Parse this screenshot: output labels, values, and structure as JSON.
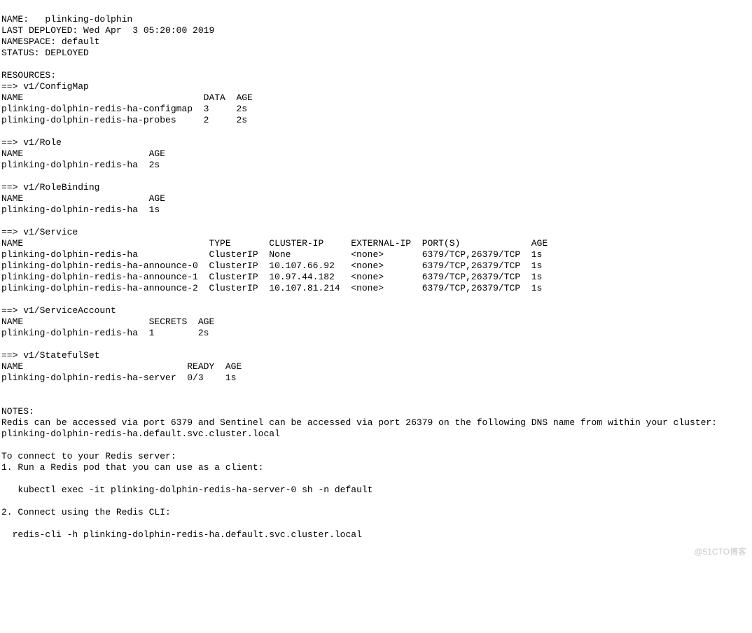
{
  "header": {
    "name_line": "NAME:   plinking-dolphin",
    "last_deployed": "LAST DEPLOYED: Wed Apr  3 05:20:00 2019",
    "namespace": "NAMESPACE: default",
    "status": "STATUS: DEPLOYED"
  },
  "sections": {
    "resources_heading": "RESOURCES:",
    "configmap": {
      "heading": "==> v1/ConfigMap",
      "headers": "NAME                                 DATA  AGE",
      "rows": [
        "plinking-dolphin-redis-ha-configmap  3     2s",
        "plinking-dolphin-redis-ha-probes     2     2s"
      ]
    },
    "role": {
      "heading": "==> v1/Role",
      "headers": "NAME                       AGE",
      "rows": [
        "plinking-dolphin-redis-ha  2s"
      ]
    },
    "rolebinding": {
      "heading": "==> v1/RoleBinding",
      "headers": "NAME                       AGE",
      "rows": [
        "plinking-dolphin-redis-ha  1s"
      ]
    },
    "service": {
      "heading": "==> v1/Service",
      "headers": "NAME                                  TYPE       CLUSTER-IP     EXTERNAL-IP  PORT(S)             AGE",
      "rows": [
        "plinking-dolphin-redis-ha             ClusterIP  None           <none>       6379/TCP,26379/TCP  1s",
        "plinking-dolphin-redis-ha-announce-0  ClusterIP  10.107.66.92   <none>       6379/TCP,26379/TCP  1s",
        "plinking-dolphin-redis-ha-announce-1  ClusterIP  10.97.44.182   <none>       6379/TCP,26379/TCP  1s",
        "plinking-dolphin-redis-ha-announce-2  ClusterIP  10.107.81.214  <none>       6379/TCP,26379/TCP  1s"
      ]
    },
    "serviceaccount": {
      "heading": "==> v1/ServiceAccount",
      "headers": "NAME                       SECRETS  AGE",
      "rows": [
        "plinking-dolphin-redis-ha  1        2s"
      ]
    },
    "statefulset": {
      "heading": "==> v1/StatefulSet",
      "headers": "NAME                              READY  AGE",
      "rows": [
        "plinking-dolphin-redis-ha-server  0/3    1s"
      ]
    }
  },
  "notes": {
    "heading": "NOTES:",
    "lines": [
      "Redis can be accessed via port 6379 and Sentinel can be accessed via port 26379 on the following DNS name from within your cluster:",
      "plinking-dolphin-redis-ha.default.svc.cluster.local",
      "To connect to your Redis server:",
      "1. Run a Redis pod that you can use as a client:",
      "   kubectl exec -it plinking-dolphin-redis-ha-server-0 sh -n default",
      "2. Connect using the Redis CLI:",
      "  redis-cli -h plinking-dolphin-redis-ha.default.svc.cluster.local"
    ]
  },
  "watermark": {
    "text": "@51CTO博客"
  }
}
